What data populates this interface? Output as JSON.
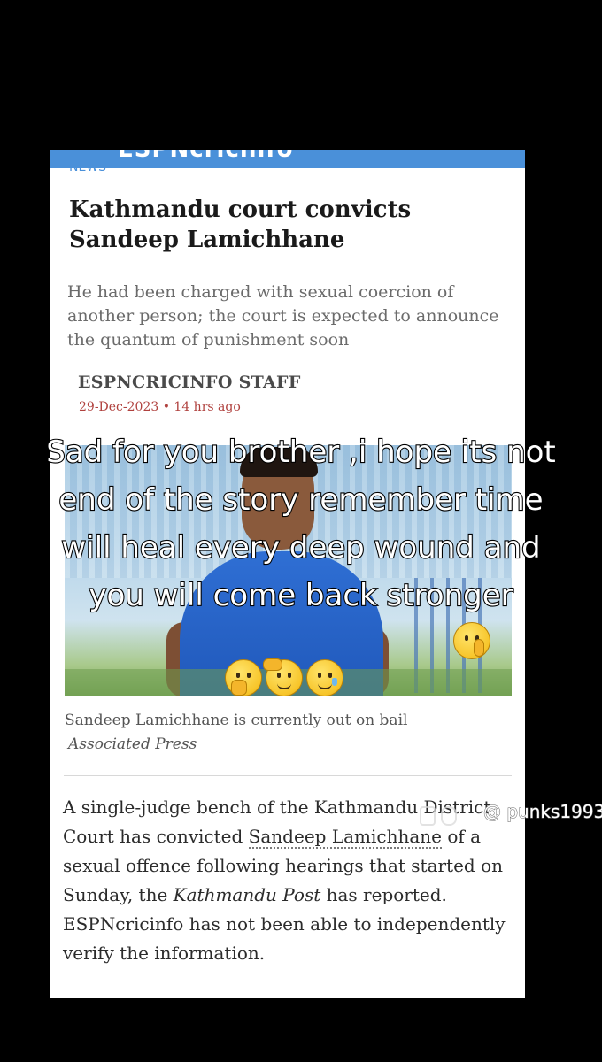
{
  "app": {
    "brand": "ESPNcricinfo",
    "accent_color": "#4a90d9"
  },
  "article": {
    "section": "NEWS",
    "headline": "Kathmandu court convicts Sandeep Lamichhane",
    "standfirst": "He had been charged with sexual coercion of another person; the court is expected to announce the quantum of punishment soon",
    "byline": "ESPNCRICINFO STAFF",
    "dateline": "29-Dec-2023 • 14 hrs ago",
    "photo_caption": "Sandeep Lamichhane is currently out on bail",
    "photo_credit": "Associated Press",
    "body": {
      "part1": "A single-judge bench of the Kathmandu District Court has convicted ",
      "link_text": "Sandeep Lamichhane",
      "part2": " of a sexual offence following hearings that started on Sunday, the ",
      "publication": "Kathmandu Post",
      "part3": " has reported. ESPNcricinfo has not been able to independently verify the information."
    }
  },
  "overlay": {
    "caption": "Sad for you brother ,i hope its not end of the story remember time will heal every deep wound and you will come back stronger",
    "emojis": [
      "shushing-face-icon",
      "thinking-face-icon",
      "saluting-face-icon",
      "face-holding-back-tears-icon"
    ]
  },
  "watermark": {
    "username": "@ punks1993"
  }
}
